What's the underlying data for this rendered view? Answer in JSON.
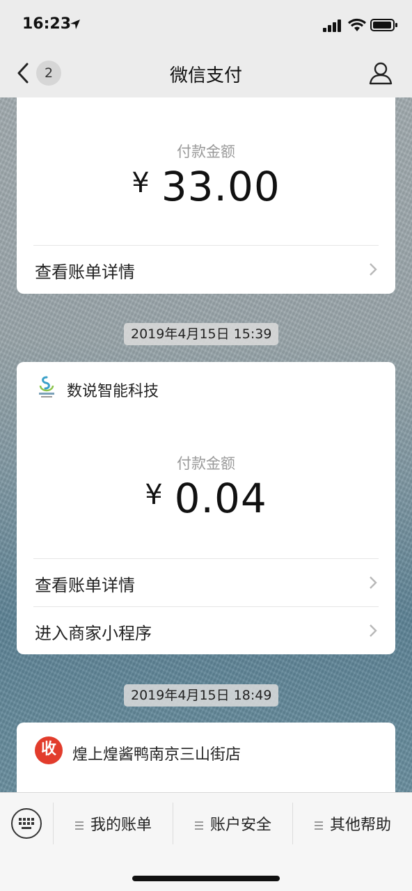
{
  "status_bar": {
    "time": "16:23"
  },
  "nav": {
    "back_count": "2",
    "title": "微信支付"
  },
  "cards": [
    {
      "amount_label": "付款金额",
      "currency": "¥",
      "amount": "33.00",
      "rows": [
        "查看账单详情"
      ]
    },
    {
      "timestamp": "2019年4月15日 15:39",
      "merchant": "数说智能科技",
      "amount_label": "付款金额",
      "currency": "¥",
      "amount": "0.04",
      "rows": [
        "查看账单详情",
        "进入商家小程序"
      ]
    },
    {
      "timestamp": "2019年4月15日 18:49",
      "merchant": "煌上煌酱鸭南京三山街店",
      "logo_text": "收"
    }
  ],
  "tabbar": {
    "items": [
      "我的账单",
      "账户安全",
      "其他帮助"
    ]
  },
  "colors": {
    "nav_bg": "#ececec",
    "logo_red": "#e23c2c"
  }
}
